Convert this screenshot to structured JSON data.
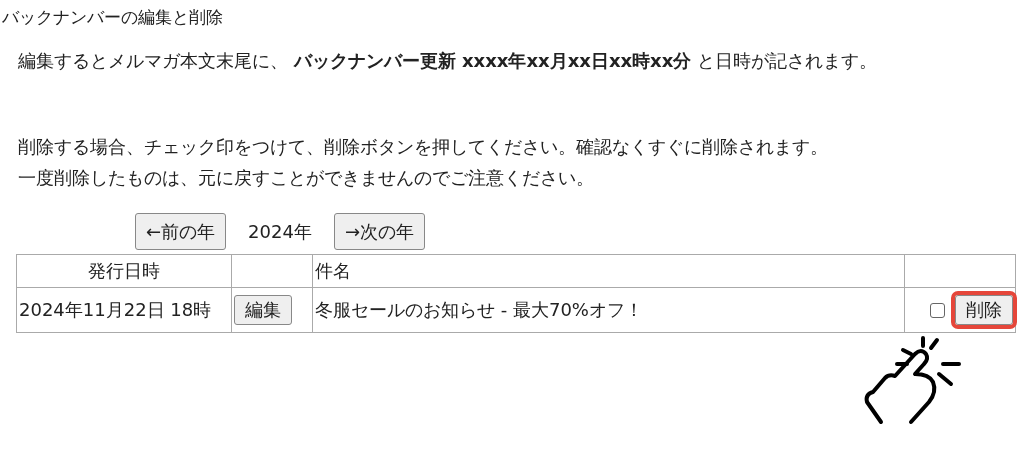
{
  "title": "バックナンバーの編集と削除",
  "note": "編集するとメルマガ本文末尾に、 **バックナンバー更新  xxxx年xx月xx日xx時xx分** と日時が記されます。",
  "instructions": [
    " 削除する場合、チェック印をつけて、削除ボタンを押してください。確認なくすぐに削除されます。",
    "一度削除したものは、元に戻すことができませんのでご注意ください。"
  ],
  "year_nav": {
    "prev": "←前の年",
    "year": "2024年",
    "next": "→次の年"
  },
  "table": {
    "columns": [
      "発行日時",
      "",
      "件名",
      ""
    ],
    "rows": [
      {
        "date": "2024年11月22日 18時",
        "edit": "編集",
        "subject": "冬服セールのお知らせ - 最大70%オフ！",
        "checked": false,
        "delete": "削除",
        "highlighted": true
      }
    ]
  }
}
